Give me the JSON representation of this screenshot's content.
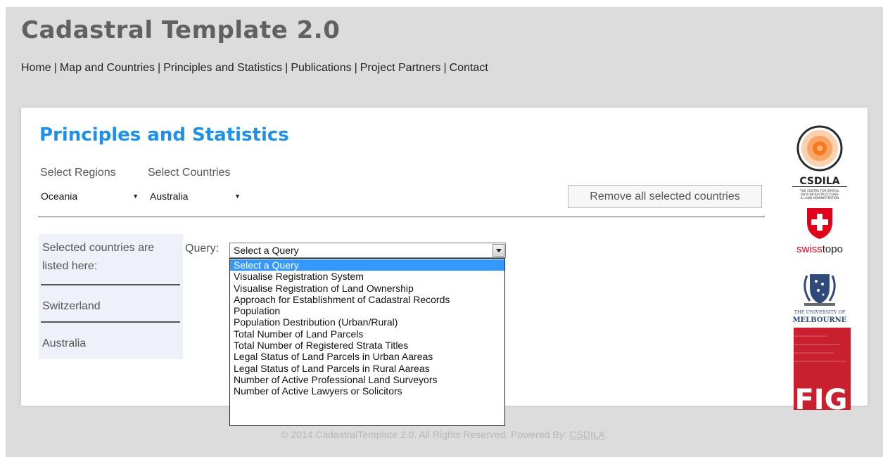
{
  "site": {
    "title": "Cadastral Template 2.0"
  },
  "nav": [
    {
      "label": "Home"
    },
    {
      "label": "Map and Countries"
    },
    {
      "label": "Principles and Statistics"
    },
    {
      "label": "Publications"
    },
    {
      "label": "Project Partners"
    },
    {
      "label": "Contact"
    }
  ],
  "nav_separator": "|",
  "panel": {
    "title": "Principles and Statistics",
    "regions_label": "Select Regions",
    "countries_label": "Select Countries",
    "region_value": "Oceania",
    "country_value": "Australia",
    "remove_button": "Remove all selected countries"
  },
  "selected": {
    "heading": "Selected countries are listed here:",
    "countries": [
      "Switzerland",
      "Australia"
    ]
  },
  "query": {
    "label": "Query:",
    "value": "Select a Query",
    "options": [
      "Select a Query",
      "Visualise Registration System",
      "Visualise Registration of Land Ownership",
      "Approach for Establishment of Cadastral Records",
      "Population",
      "Population Destribution (Urban/Rural)",
      "Total Number of Land Parcels",
      "Total Number of Registered Strata Titles",
      "Legal Status of Land Parcels in Urban Aareas",
      "Legal Status of Land Parcels in Rural Aareas",
      "Number of Active Professional Land Surveyors",
      "Number of Active Lawyers or Solicitors"
    ],
    "highlighted_index": 0
  },
  "logos": {
    "csdila": {
      "name": "CSDILA",
      "tagline": "THE CENTRE FOR SPATIAL DATA INFRASTRUCTURES & LAND ADMINISTRATION"
    },
    "swisstopo": {
      "part1": "swiss",
      "part2": "topo"
    },
    "melbourne": {
      "line1": "THE UNIVERSITY OF",
      "line2": "MELBOURNE"
    },
    "fig": {
      "text": "FIG"
    }
  },
  "footer": {
    "text": "© 2014 CadastralTemplate 2.0. All Rights Reserved. Powered By:",
    "link": "CSDILA",
    "end": "."
  },
  "colors": {
    "accent_blue": "#1e90e8",
    "highlight": "#3399ff",
    "swiss_red": "#e3001b",
    "fig_red": "#c8202f"
  }
}
